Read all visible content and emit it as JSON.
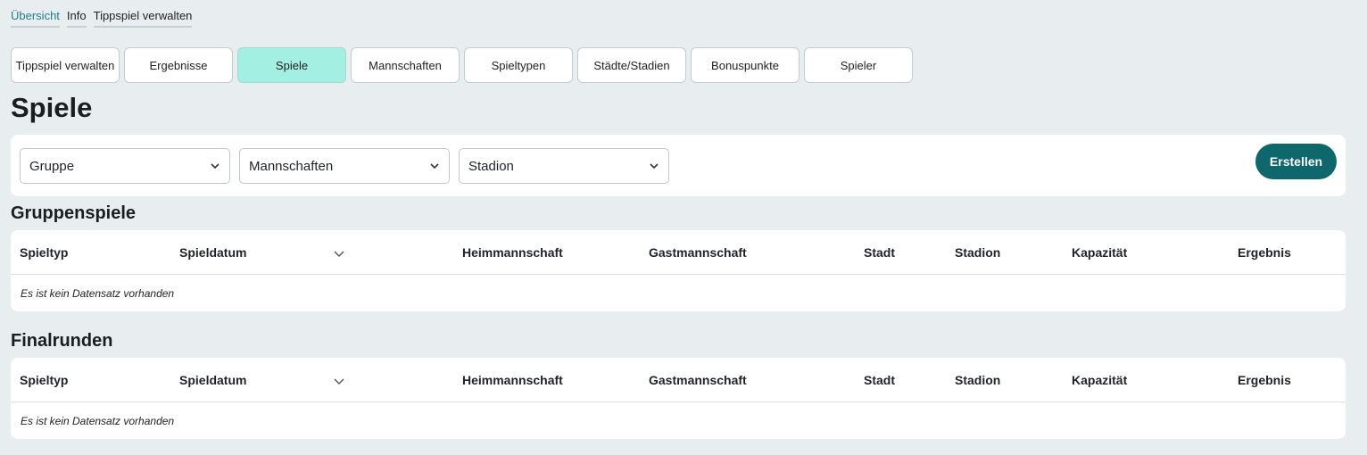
{
  "breadcrumb": [
    "Übersicht",
    "Info",
    "Tippspiel verwalten"
  ],
  "tabs": [
    {
      "label": "Tippspiel verwalten",
      "active": false
    },
    {
      "label": "Ergebnisse",
      "active": false
    },
    {
      "label": "Spiele",
      "active": true
    },
    {
      "label": "Mannschaften",
      "active": false
    },
    {
      "label": "Spieltypen",
      "active": false
    },
    {
      "label": "Städte/Stadien",
      "active": false
    },
    {
      "label": "Bonuspunkte",
      "active": false
    },
    {
      "label": "Spieler",
      "active": false
    }
  ],
  "page_title": "Spiele",
  "filters": {
    "group": "Gruppe",
    "teams": "Mannschaften",
    "stadium": "Stadion",
    "create_label": "Erstellen"
  },
  "columns": [
    "Spieltyp",
    "Spieldatum",
    "Heimmannschaft",
    "Gastmannschaft",
    "Stadt",
    "Stadion",
    "Kapazität",
    "Ergebnis"
  ],
  "sections": [
    {
      "title": "Gruppenspiele",
      "empty_text": "Es ist kein Datensatz vorhanden"
    },
    {
      "title": "Finalrunden",
      "empty_text": "Es ist kein Datensatz vorhanden"
    }
  ],
  "colors": {
    "accent": "#0d676b",
    "active_tab": "#a3efe1",
    "active_crumb": "#1e7f86",
    "background": "#e8edf0"
  },
  "icons": {
    "select_arrow": "chevron-down-icon",
    "sort": "chevron-down-icon"
  }
}
